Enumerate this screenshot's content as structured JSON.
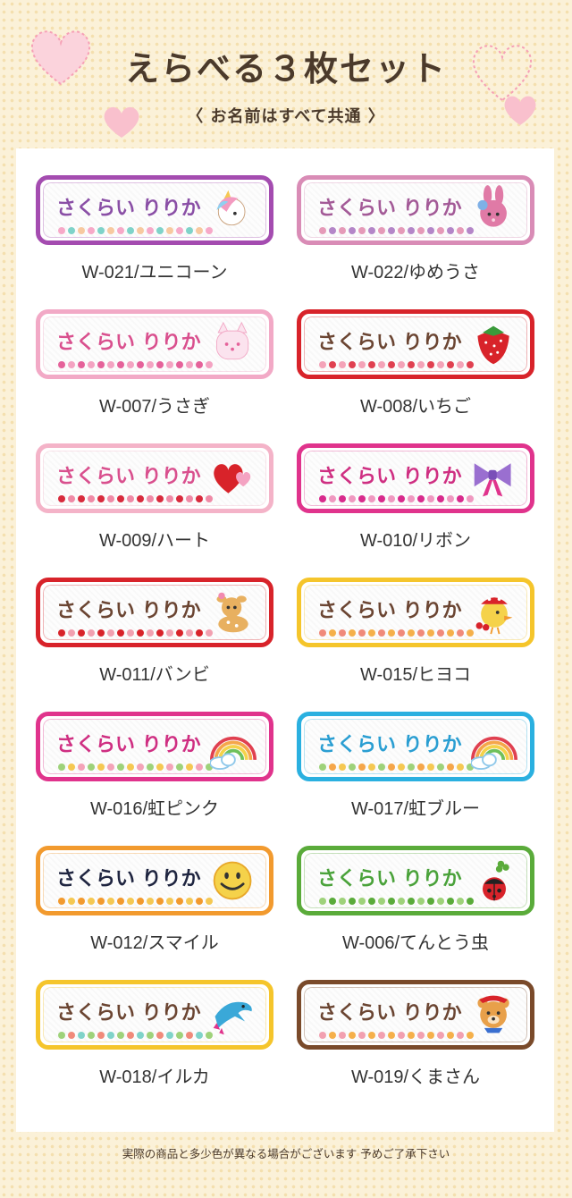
{
  "header": {
    "title": "えらべる３枚セット",
    "subtitle": "〈 お名前はすべて共通 〉"
  },
  "items": [
    {
      "code": "W-021/ユニコーン",
      "name": "さくらい りりか",
      "border": "#a44cb0",
      "text": "#8a4fa6",
      "dots": [
        "#f7a9c8",
        "#7fd3c9",
        "#f7c9a0"
      ],
      "icon": "unicorn-icon"
    },
    {
      "code": "W-022/ゆめうさ",
      "name": "さくらい りりか",
      "border": "#d98cb6",
      "text": "#a35a97",
      "dots": [
        "#e59ab8",
        "#b486c8"
      ],
      "icon": "dream-rabbit-icon"
    },
    {
      "code": "W-007/うさぎ",
      "name": "さくらい りりか",
      "border": "#f2a9c6",
      "text": "#d9508e",
      "dots": [
        "#e5629a",
        "#f4a3c2"
      ],
      "icon": "rabbit-icon"
    },
    {
      "code": "W-008/いちご",
      "name": "さくらい りりか",
      "border": "#d8232a",
      "text": "#6b4532",
      "dots": [
        "#f4a3b8",
        "#e04050"
      ],
      "icon": "strawberry-icon"
    },
    {
      "code": "W-009/ハート",
      "name": "さくらい りりか",
      "border": "#f4b3c8",
      "text": "#d9508e",
      "dots": [
        "#d82a3c",
        "#f08aa6"
      ],
      "icon": "heart-icon"
    },
    {
      "code": "W-010/リボン",
      "name": "さくらい りりか",
      "border": "#e0338c",
      "text": "#cf2f82",
      "dots": [
        "#d82a8c",
        "#f098c0"
      ],
      "icon": "ribbon-icon"
    },
    {
      "code": "W-011/バンビ",
      "name": "さくらい りりか",
      "border": "#d8232a",
      "text": "#6b4532",
      "dots": [
        "#d8232a",
        "#f2a0b0"
      ],
      "icon": "bambi-icon"
    },
    {
      "code": "W-015/ヒヨコ",
      "name": "さくらい りりか",
      "border": "#f5c52b",
      "text": "#6b4532",
      "dots": [
        "#f08a7a",
        "#f5b04a"
      ],
      "icon": "chick-icon"
    },
    {
      "code": "W-016/虹ピンク",
      "name": "さくらい りりか",
      "border": "#e0338c",
      "text": "#cf2f82",
      "dots": [
        "#9ed27a",
        "#f5c852",
        "#f4a3b8"
      ],
      "icon": "rainbow-icon"
    },
    {
      "code": "W-017/虹ブルー",
      "name": "さくらい りりか",
      "border": "#2ab0e0",
      "text": "#2a9ed2",
      "dots": [
        "#9ed27a",
        "#f5a64a",
        "#f5c852"
      ],
      "icon": "rainbow-icon"
    },
    {
      "code": "W-012/スマイル",
      "name": "さくらい りりか",
      "border": "#f29a2e",
      "text": "#1f2540",
      "dots": [
        "#f29a2e",
        "#f5c852"
      ],
      "icon": "smiley-icon"
    },
    {
      "code": "W-006/てんとう虫",
      "name": "さくらい りりか",
      "border": "#5aab3a",
      "text": "#4aa23a",
      "dots": [
        "#9ed27a",
        "#5aab3a"
      ],
      "icon": "ladybug-icon"
    },
    {
      "code": "W-018/イルカ",
      "name": "さくらい りりか",
      "border": "#f5c52b",
      "text": "#6b4532",
      "dots": [
        "#9ed27a",
        "#f08a7a",
        "#7fd3c9"
      ],
      "icon": "dolphin-icon"
    },
    {
      "code": "W-019/くまさん",
      "name": "さくらい りりか",
      "border": "#7a4a2a",
      "text": "#6b4532",
      "dots": [
        "#f2a0b0",
        "#f5b04a"
      ],
      "icon": "bear-icon"
    }
  ],
  "footer": {
    "note": "実際の商品と多少色が異なる場合がございます 予めご了承下さい"
  }
}
